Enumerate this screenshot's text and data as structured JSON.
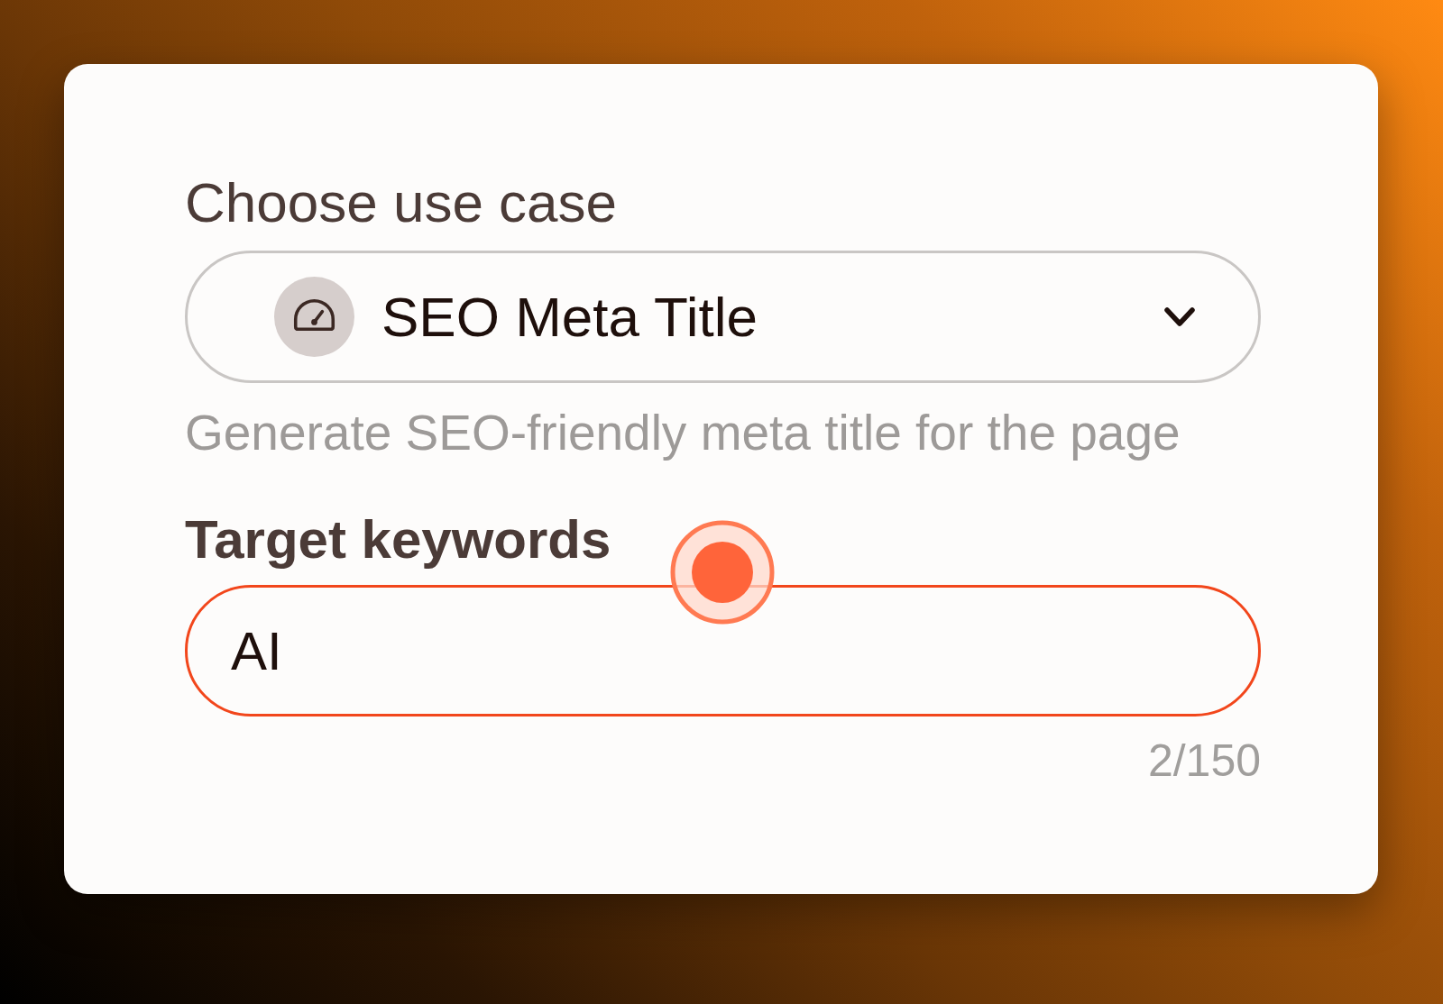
{
  "use_case": {
    "label": "Choose use case",
    "value": "SEO Meta Title",
    "description": "Generate SEO-friendly meta title for the page"
  },
  "target_keywords": {
    "label": "Target keywords",
    "value": "AI",
    "focused": true,
    "counter": "2/150"
  }
}
